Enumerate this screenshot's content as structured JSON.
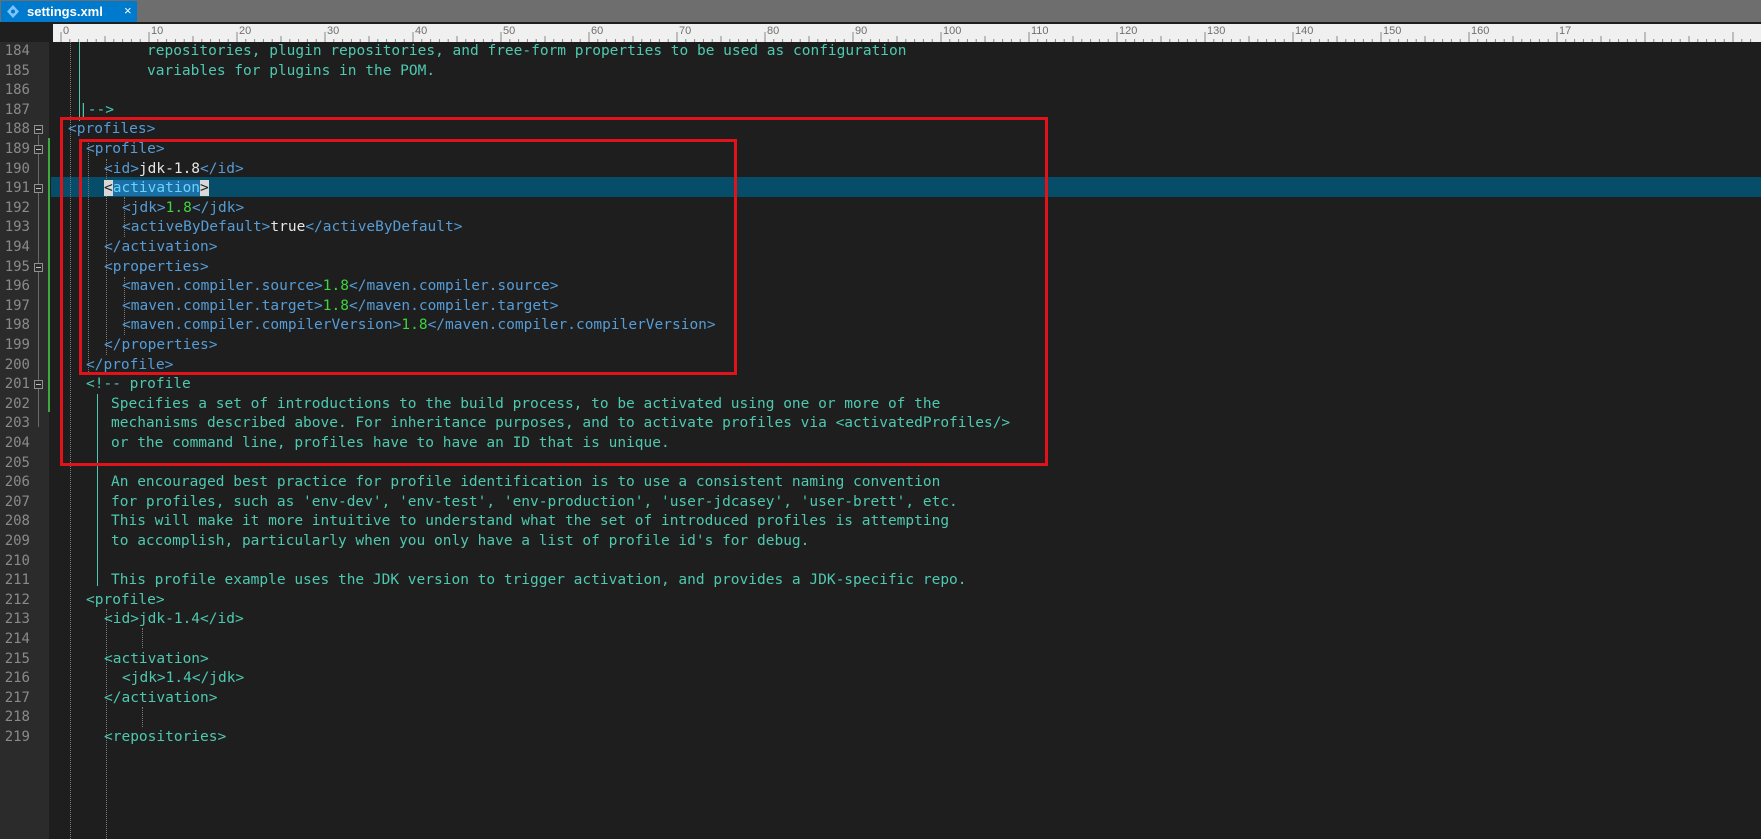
{
  "tab": {
    "filename": "settings.xml",
    "close_glyph": "×"
  },
  "ruler": {
    "labels": [
      "0",
      "10",
      "20",
      "30",
      "40",
      "50",
      "60",
      "70",
      "80",
      "90",
      "100",
      "110",
      "120",
      "130",
      "140",
      "150",
      "160",
      "17"
    ]
  },
  "gutter": {
    "line_numbers": [
      "184",
      "185",
      "186",
      "187",
      "188",
      "189",
      "190",
      "191",
      "192",
      "193",
      "194",
      "195",
      "196",
      "197",
      "198",
      "199",
      "200",
      "201",
      "202",
      "203",
      "204",
      "205",
      "206",
      "207",
      "208",
      "209",
      "210",
      "211",
      "212",
      "213",
      "214",
      "215",
      "216",
      "217",
      "218",
      "219"
    ],
    "folds": [
      "188",
      "189",
      "191",
      "195",
      "201"
    ]
  },
  "code": {
    "l184": "repositories, plugin repositories, and free-form properties to be used as configuration",
    "l185": "variables for plugins in the POM.",
    "l187": "|-->",
    "l188_open": "<profiles>",
    "l189_open": "<profile>",
    "l190_open": "<id>",
    "l190_val": "jdk-1.8",
    "l190_close": "</id>",
    "l191_lt": "<",
    "l191_name": "activation",
    "l191_gt": ">",
    "l192_open": "<jdk>",
    "l192_val": "1.8",
    "l192_close": "</jdk>",
    "l193_open": "<activeByDefault>",
    "l193_val": "true",
    "l193_close": "</activeByDefault>",
    "l194": "</activation>",
    "l195": "<properties>",
    "l196_open": "<maven.compiler.source>",
    "l196_val": "1.8",
    "l196_close": "</maven.compiler.source>",
    "l197_open": "<maven.compiler.target>",
    "l197_val": "1.8",
    "l197_close": "</maven.compiler.target>",
    "l198_open": "<maven.compiler.compilerVersion>",
    "l198_val": "1.8",
    "l198_close": "</maven.compiler.compilerVersion>",
    "l199": "</properties>",
    "l200": "</profile>",
    "l201": "<!-- profile",
    "l202": "Specifies a set of introductions to the build process, to be activated using one or more of the",
    "l203": "mechanisms described above. For inheritance purposes, and to activate profiles via <activatedProfiles/>",
    "l204": "or the command line, profiles have to have an ID that is unique.",
    "l206": "An encouraged best practice for profile identification is to use a consistent naming convention",
    "l207": "for profiles, such as 'env-dev', 'env-test', 'env-production', 'user-jdcasey', 'user-brett', etc.",
    "l208": "This will make it more intuitive to understand what the set of introduced profiles is attempting",
    "l209": "to accomplish, particularly when you only have a list of profile id's for debug.",
    "l211": "This profile example uses the JDK version to trigger activation, and provides a JDK-specific repo.",
    "l212": "<profile>",
    "l213": "<id>jdk-1.4</id>",
    "l215": "<activation>",
    "l216": "<jdk>1.4</jdk>",
    "l217": "</activation>",
    "l219": "<repositories>"
  },
  "colors": {
    "background": "#1e1e1e",
    "tab_active": "#007acc",
    "comment": "#4ec9b0",
    "tag": "#569cd6",
    "number": "#3fd33f",
    "current_line": "#064d6a",
    "annotation_box": "#e0121a"
  }
}
